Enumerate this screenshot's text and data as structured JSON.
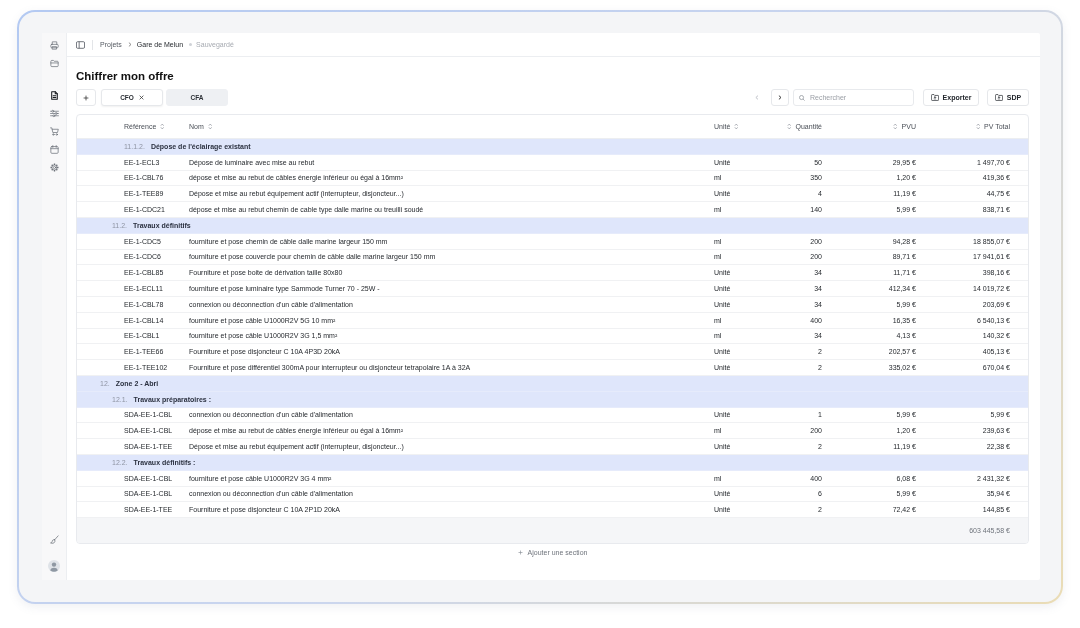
{
  "sidebar": {
    "items": [
      {
        "selected": false
      },
      {
        "selected": false
      },
      {
        "selected": true
      },
      {
        "selected": false
      },
      {
        "selected": false
      },
      {
        "selected": false
      },
      {
        "selected": false
      }
    ]
  },
  "breadcrumb": {
    "items": [
      "Projets",
      "Gare de Melun"
    ],
    "status": "Sauvegardé"
  },
  "page": {
    "title": "Chiffrer mon offre"
  },
  "tabs": [
    {
      "label": "CFO",
      "selected": true
    },
    {
      "label": "CFA",
      "selected": false
    }
  ],
  "pager": {
    "previous": {
      "disabled": true
    },
    "next": {
      "disabled": false
    }
  },
  "search": {
    "placeholder": "Rechercher"
  },
  "buttons": [
    "Exporter",
    "SDP"
  ],
  "table": {
    "columns": [
      "Référence",
      "Nom",
      "Unité",
      "Quantité",
      "PVU",
      "PV Total"
    ],
    "sections": [
      {
        "children": [
          {
            "children": [
              {
                "number": "11.1.2.",
                "title": "Dépose de l'éclairage existant",
                "items": [
                  {
                    "reference": "EE-1-ECL3",
                    "name": "Dépose de luminaire avec mise au rebut",
                    "unit": "Unité",
                    "quantity": "50",
                    "unit_price": "29,95 €",
                    "total": "1 497,70 €"
                  },
                  {
                    "reference": "EE-1-CBL76",
                    "name": "dépose et mise au rebut de câbles énergie inférieur ou égal à 16mm²",
                    "unit": "ml",
                    "quantity": "350",
                    "unit_price": "1,20 €",
                    "total": "419,36 €"
                  },
                  {
                    "reference": "EE-1-TEE89",
                    "name": "Dépose et mise au rebut équipement actif (interrupteur, disjoncteur...)",
                    "unit": "Unité",
                    "quantity": "4",
                    "unit_price": "11,19 €",
                    "total": "44,75 €"
                  },
                  {
                    "reference": "EE-1-CDC21",
                    "name": "dépose et mise au rebut chemin de cable type dalle marine ou treuilli soudé",
                    "unit": "ml",
                    "quantity": "140",
                    "unit_price": "5,99 €",
                    "total": "838,71 €"
                  }
                ]
              }
            ]
          },
          {
            "number": "11.2.",
            "title": "Travaux définitifs",
            "items": [
              {
                "reference": "EE-1-CDC5",
                "name": "fourniture et pose chemin de câble dalle marine largeur 150 mm",
                "unit": "ml",
                "quantity": "200",
                "unit_price": "94,28 €",
                "total": "18 855,07 €"
              },
              {
                "reference": "EE-1-CDC6",
                "name": "fourniture et pose couvercle pour chemin de câble dalle marine largeur 150 mm",
                "unit": "ml",
                "quantity": "200",
                "unit_price": "89,71 €",
                "total": "17 941,61 €"
              },
              {
                "reference": "EE-1-CBL85",
                "name": "Fourniture et pose boite de dérivation taille 80x80",
                "unit": "Unité",
                "quantity": "34",
                "unit_price": "11,71 €",
                "total": "398,16 €"
              },
              {
                "reference": "EE-1-ECL11",
                "name": "fourniture et pose luminaire type Sammode Turner 70 - 25W -",
                "unit": "Unité",
                "quantity": "34",
                "unit_price": "412,34 €",
                "total": "14 019,72 €"
              },
              {
                "reference": "EE-1-CBL78",
                "name": "connexion ou déconnection d'un câble d'alimentation",
                "unit": "Unité",
                "quantity": "34",
                "unit_price": "5,99 €",
                "total": "203,69 €"
              },
              {
                "reference": "EE-1-CBL14",
                "name": "fourniture et pose câble U1000R2V 5G 10 mm²",
                "unit": "ml",
                "quantity": "400",
                "unit_price": "16,35 €",
                "total": "6 540,13 €"
              },
              {
                "reference": "EE-1-CBL1",
                "name": "fourniture et pose câble U1000R2V 3G 1,5 mm²",
                "unit": "ml",
                "quantity": "34",
                "unit_price": "4,13 €",
                "total": "140,32 €"
              },
              {
                "reference": "EE-1-TEE66",
                "name": "Fourniture et pose disjoncteur C 10A 4P3D 20kA",
                "unit": "Unité",
                "quantity": "2",
                "unit_price": "202,57 €",
                "total": "405,13 €"
              },
              {
                "reference": "EE-1-TEE102",
                "name": "Fourniture et pose différentiel 300mA pour interrupteur ou disjoncteur tetrapolaire 1A à 32A",
                "unit": "Unité",
                "quantity": "2",
                "unit_price": "335,02 €",
                "total": "670,04 €"
              }
            ]
          }
        ]
      },
      {
        "number": "12.",
        "title": "Zone 2 - Abri",
        "children": [
          {
            "number": "12.1.",
            "title": "Travaux préparatoires :",
            "items": [
              {
                "reference": "SDA-EE-1-CBL",
                "name": "connexion ou déconnection d'un câble d'alimentation",
                "unit": "Unité",
                "quantity": "1",
                "unit_price": "5,99 €",
                "total": "5,99 €"
              },
              {
                "reference": "SDA-EE-1-CBL",
                "name": "dépose et mise au rebut de câbles énergie inférieur ou égal à 16mm²",
                "unit": "ml",
                "quantity": "200",
                "unit_price": "1,20 €",
                "total": "239,63 €"
              },
              {
                "reference": "SDA-EE-1-TEE",
                "name": "Dépose et mise au rebut équipement actif (interrupteur, disjoncteur...)",
                "unit": "Unité",
                "quantity": "2",
                "unit_price": "11,19 €",
                "total": "22,38 €"
              }
            ]
          },
          {
            "number": "12.2.",
            "title": "Travaux définitifs :",
            "items": [
              {
                "reference": "SDA-EE-1-CBL",
                "name": "fourniture et pose câble U1000R2V 3G 4 mm²",
                "unit": "ml",
                "quantity": "400",
                "unit_price": "6,08 €",
                "total": "2 431,32 €"
              },
              {
                "reference": "SDA-EE-1-CBL",
                "name": "connexion ou déconnection d'un câble d'alimentation",
                "unit": "Unité",
                "quantity": "6",
                "unit_price": "5,99 €",
                "total": "35,94 €"
              },
              {
                "reference": "SDA-EE-1-TEE",
                "name": "Fourniture et pose disjoncteur C 10A 2P1D 20kA",
                "unit": "Unité",
                "quantity": "2",
                "unit_price": "72,42 €",
                "total": "144,85 €"
              }
            ]
          }
        ]
      }
    ],
    "total": "603 445,58 €"
  },
  "add_section": "Ajouter une section"
}
